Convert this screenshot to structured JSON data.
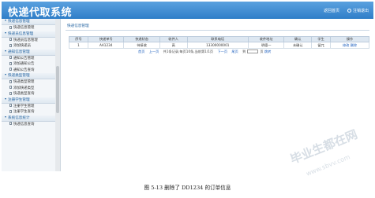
{
  "header": {
    "title": "快递代取系统",
    "back_label": "返回首页",
    "logout_label": "注销退出"
  },
  "sidebar": {
    "groups": [
      {
        "title": "快递信息管理",
        "items": [
          "快递信息管理"
        ]
      },
      {
        "title": "快递员信息管理",
        "items": [
          "快递员信息管理",
          "添加快递员"
        ]
      },
      {
        "title": "通知信息管理",
        "items": [
          "通知公告管理",
          "添加通知公告",
          "通知公告查询"
        ]
      },
      {
        "title": "快递类型管理",
        "items": [
          "快递类型管理",
          "添加快递类型",
          "快递类型查询"
        ]
      },
      {
        "title": "注册学生管理",
        "items": [
          "注册学生管理",
          "注册学生查询"
        ]
      },
      {
        "title": "系统信息统计",
        "items": [
          "快递信息查询"
        ]
      }
    ]
  },
  "content": {
    "breadcrumb": "快递信息管理",
    "table": {
      "headers": [
        "序号",
        "快递单号",
        "快递状态",
        "收件人",
        "联系电话",
        "收件地址",
        "确认",
        "学生",
        "操作"
      ],
      "rows": [
        {
          "index": "1",
          "number": "AA1234",
          "status": "待接收",
          "receiver": "高",
          "phone": "13300000001",
          "address": "明德一",
          "confirm": "未确认",
          "student": "留兀",
          "edit": "修改",
          "delete": "删除"
        }
      ]
    },
    "pager": {
      "first": "首页",
      "prev": "上一页",
      "info": "共1条记录,每页10条,当前第1/1页",
      "next": "下一页",
      "last": "尾页",
      "goto_prefix": "到",
      "goto_suffix": "页",
      "go_label": "跳转"
    }
  },
  "caption": "图 5-13 删除了 DD1234 的订单信息",
  "watermark": {
    "text": "毕业生都在网",
    "url": "www.sbvv.com"
  }
}
